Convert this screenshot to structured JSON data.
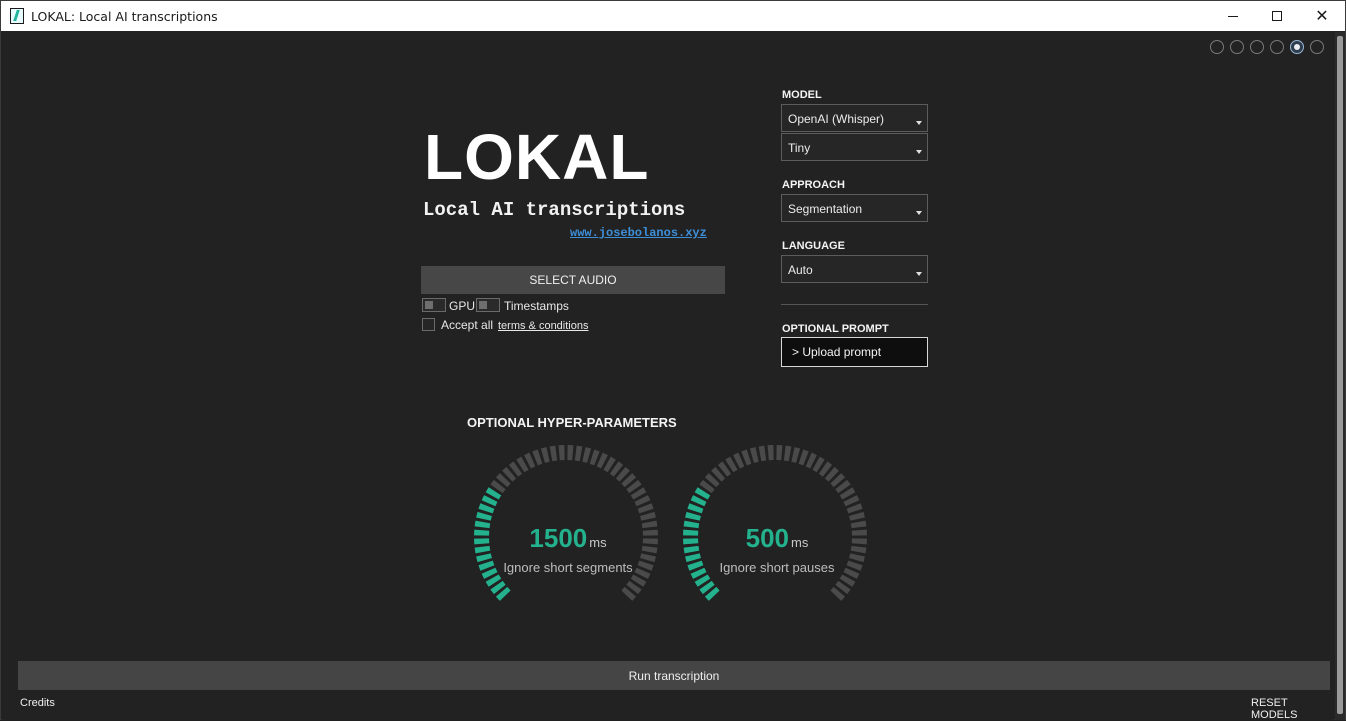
{
  "window": {
    "title": "LOKAL: Local AI transcriptions"
  },
  "header": {
    "logo": "LOKAL",
    "subtitle": "Local AI transcriptions",
    "website": "www.josebolanos.xyz"
  },
  "pagination": {
    "count": 6,
    "active_index": 4
  },
  "audio": {
    "select_label": "SELECT AUDIO",
    "gpu_label": "GPU",
    "gpu_enabled": false,
    "timestamps_label": "Timestamps",
    "timestamps_enabled": false,
    "accept_label": "Accept all",
    "terms_label": "terms & conditions",
    "accepted": false
  },
  "settings": {
    "model_heading": "MODEL",
    "model_value": "OpenAI (Whisper)",
    "model_size_value": "Tiny",
    "approach_heading": "APPROACH",
    "approach_value": "Segmentation",
    "language_heading": "LANGUAGE",
    "language_value": "Auto",
    "prompt_heading": "OPTIONAL PROMPT",
    "prompt_button": "> Upload prompt"
  },
  "hyper": {
    "title": "OPTIONAL HYPER-PARAMETERS",
    "gauges": [
      {
        "value": "1500",
        "unit": "ms",
        "label": "Ignore short segments",
        "fill_fraction": 0.3
      },
      {
        "value": "500",
        "unit": "ms",
        "label": "Ignore short pauses",
        "fill_fraction": 0.3
      }
    ]
  },
  "footer": {
    "run_label": "Run transcription",
    "credits_label": "Credits",
    "reset_label": "RESET MODELS"
  },
  "colors": {
    "accent": "#23b28d",
    "gauge_track": "#4a4a4a",
    "background": "#222222",
    "link": "#3d8fd8"
  }
}
